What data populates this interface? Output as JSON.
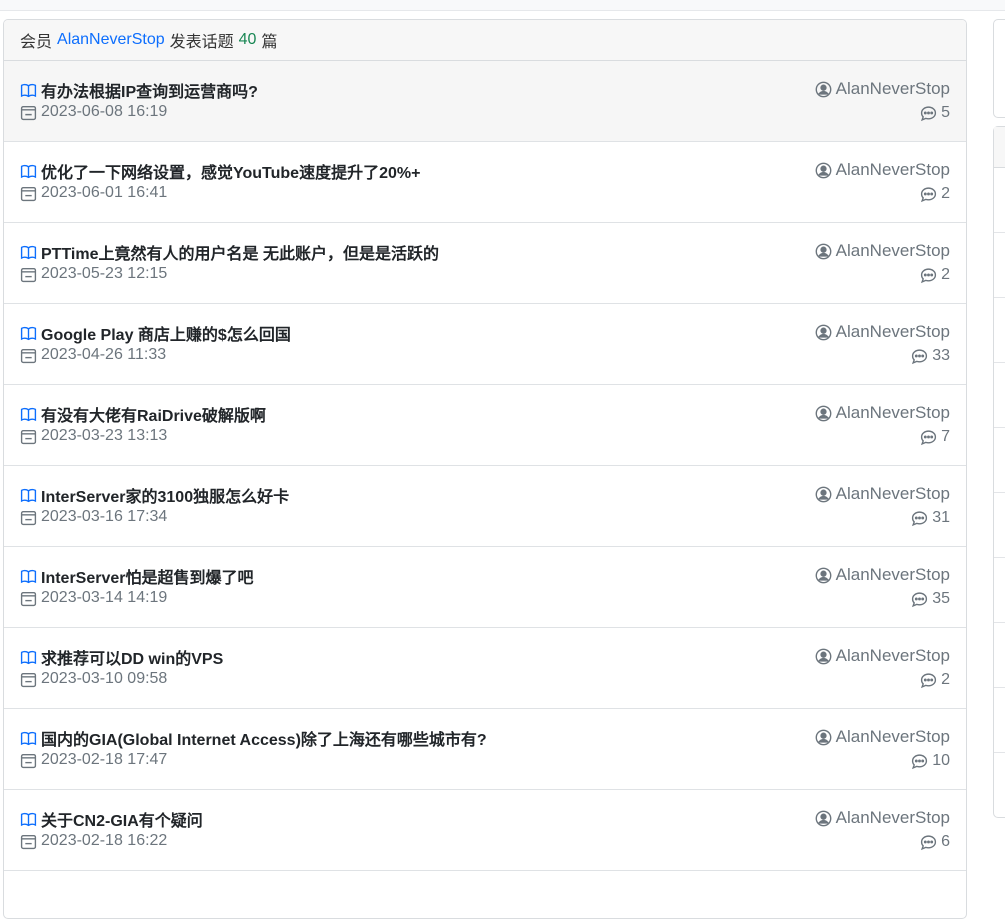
{
  "header": {
    "prefix": "会员",
    "member": "AlanNeverStop",
    "middle": "发表话题",
    "count": "40",
    "suffix": "篇"
  },
  "icons": {
    "topic": "book-icon",
    "date": "calendar-icon",
    "author": "person-circle-icon",
    "replies": "chat-icon"
  },
  "colors": {
    "link": "#0d6efd",
    "count": "#198754",
    "muted": "#6c757d"
  },
  "topics": [
    {
      "title": "有办法根据IP查询到运营商吗?",
      "date": "2023-06-08 16:19",
      "author": "AlanNeverStop",
      "replies": "5"
    },
    {
      "title": "优化了一下网络设置，感觉YouTube速度提升了20%+",
      "date": "2023-06-01 16:41",
      "author": "AlanNeverStop",
      "replies": "2"
    },
    {
      "title": "PTTime上竟然有人的用户名是 无此账户，但是是活跃的",
      "date": "2023-05-23 12:15",
      "author": "AlanNeverStop",
      "replies": "2"
    },
    {
      "title": "Google Play 商店上赚的$怎么回国",
      "date": "2023-04-26 11:33",
      "author": "AlanNeverStop",
      "replies": "33"
    },
    {
      "title": "有没有大佬有RaiDrive破解版啊",
      "date": "2023-03-23 13:13",
      "author": "AlanNeverStop",
      "replies": "7"
    },
    {
      "title": "InterServer家的3100独服怎么好卡",
      "date": "2023-03-16 17:34",
      "author": "AlanNeverStop",
      "replies": "31"
    },
    {
      "title": "InterServer怕是超售到爆了吧",
      "date": "2023-03-14 14:19",
      "author": "AlanNeverStop",
      "replies": "35"
    },
    {
      "title": "求推荐可以DD win的VPS",
      "date": "2023-03-10 09:58",
      "author": "AlanNeverStop",
      "replies": "2"
    },
    {
      "title": "国内的GIA(Global Internet Access)除了上海还有哪些城市有?",
      "date": "2023-02-18 17:47",
      "author": "AlanNeverStop",
      "replies": "10"
    },
    {
      "title": "关于CN2-GIA有个疑问",
      "date": "2023-02-18 16:22",
      "author": "AlanNeverStop",
      "replies": "6"
    }
  ]
}
